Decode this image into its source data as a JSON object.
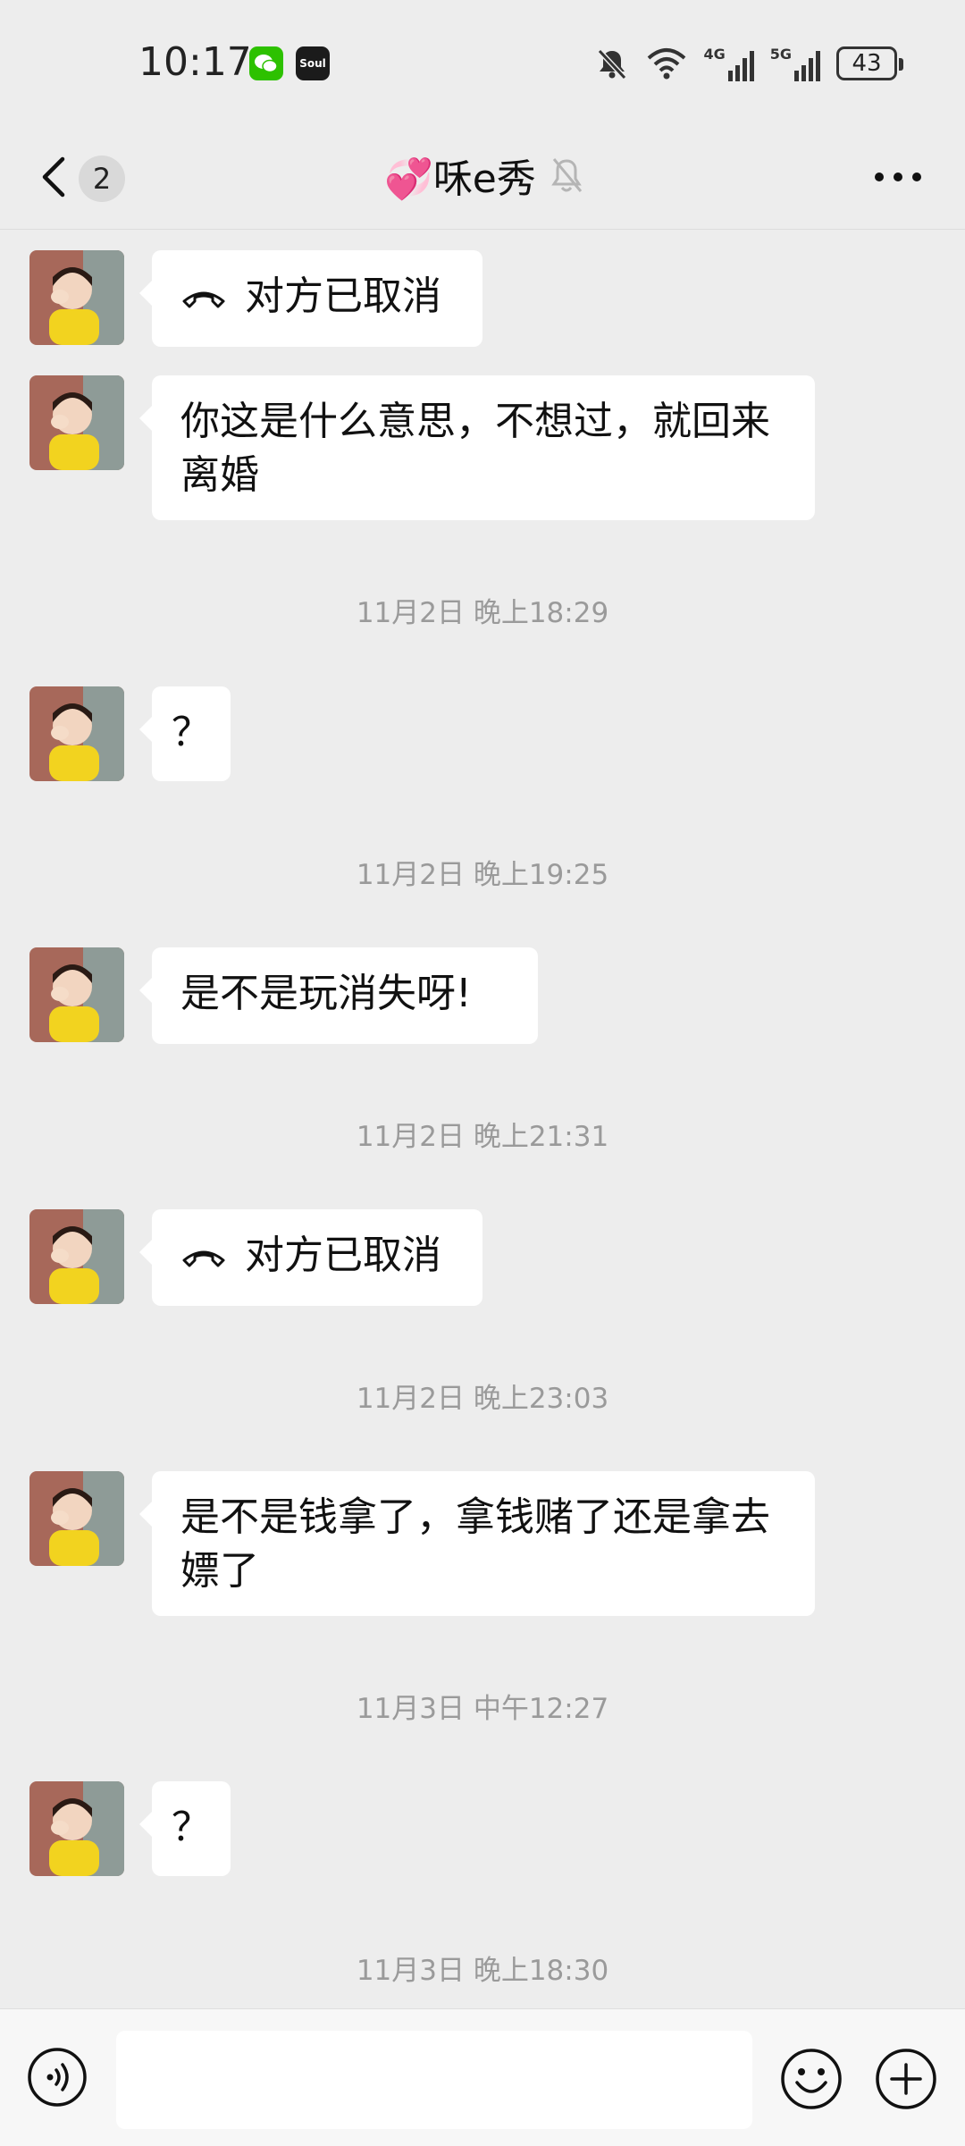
{
  "status_bar": {
    "time": "10:17",
    "soul_label": "Soul",
    "network_1": "4G",
    "network_2": "5G",
    "battery": "43"
  },
  "header": {
    "unread_count": "2",
    "title": "💞咊e秀"
  },
  "messages": [
    {
      "type": "call",
      "text": "对方已取消"
    },
    {
      "type": "text",
      "text": "你这是什么意思，不想过，就回来离婚"
    },
    {
      "type": "timestamp",
      "text": "11月2日 晚上18:29"
    },
    {
      "type": "text",
      "text": "？"
    },
    {
      "type": "timestamp",
      "text": "11月2日 晚上19:25"
    },
    {
      "type": "text",
      "text": "是不是玩消失呀!"
    },
    {
      "type": "timestamp",
      "text": "11月2日 晚上21:31"
    },
    {
      "type": "call",
      "text": "对方已取消"
    },
    {
      "type": "timestamp",
      "text": "11月2日 晚上23:03"
    },
    {
      "type": "text",
      "text": "是不是钱拿了，拿钱赌了还是拿去嫖了"
    },
    {
      "type": "timestamp",
      "text": "11月3日 中午12:27"
    },
    {
      "type": "text",
      "text": "？"
    },
    {
      "type": "timestamp",
      "text": "11月3日 晚上18:30"
    }
  ],
  "input_bar": {
    "text_value": "",
    "icons": [
      "voice-icon",
      "emoji-icon",
      "plus-icon"
    ]
  },
  "colors": {
    "background": "#ededed",
    "bubble": "#ffffff",
    "wechat_green": "#2dc100",
    "timestamp": "#9a9a9a"
  }
}
